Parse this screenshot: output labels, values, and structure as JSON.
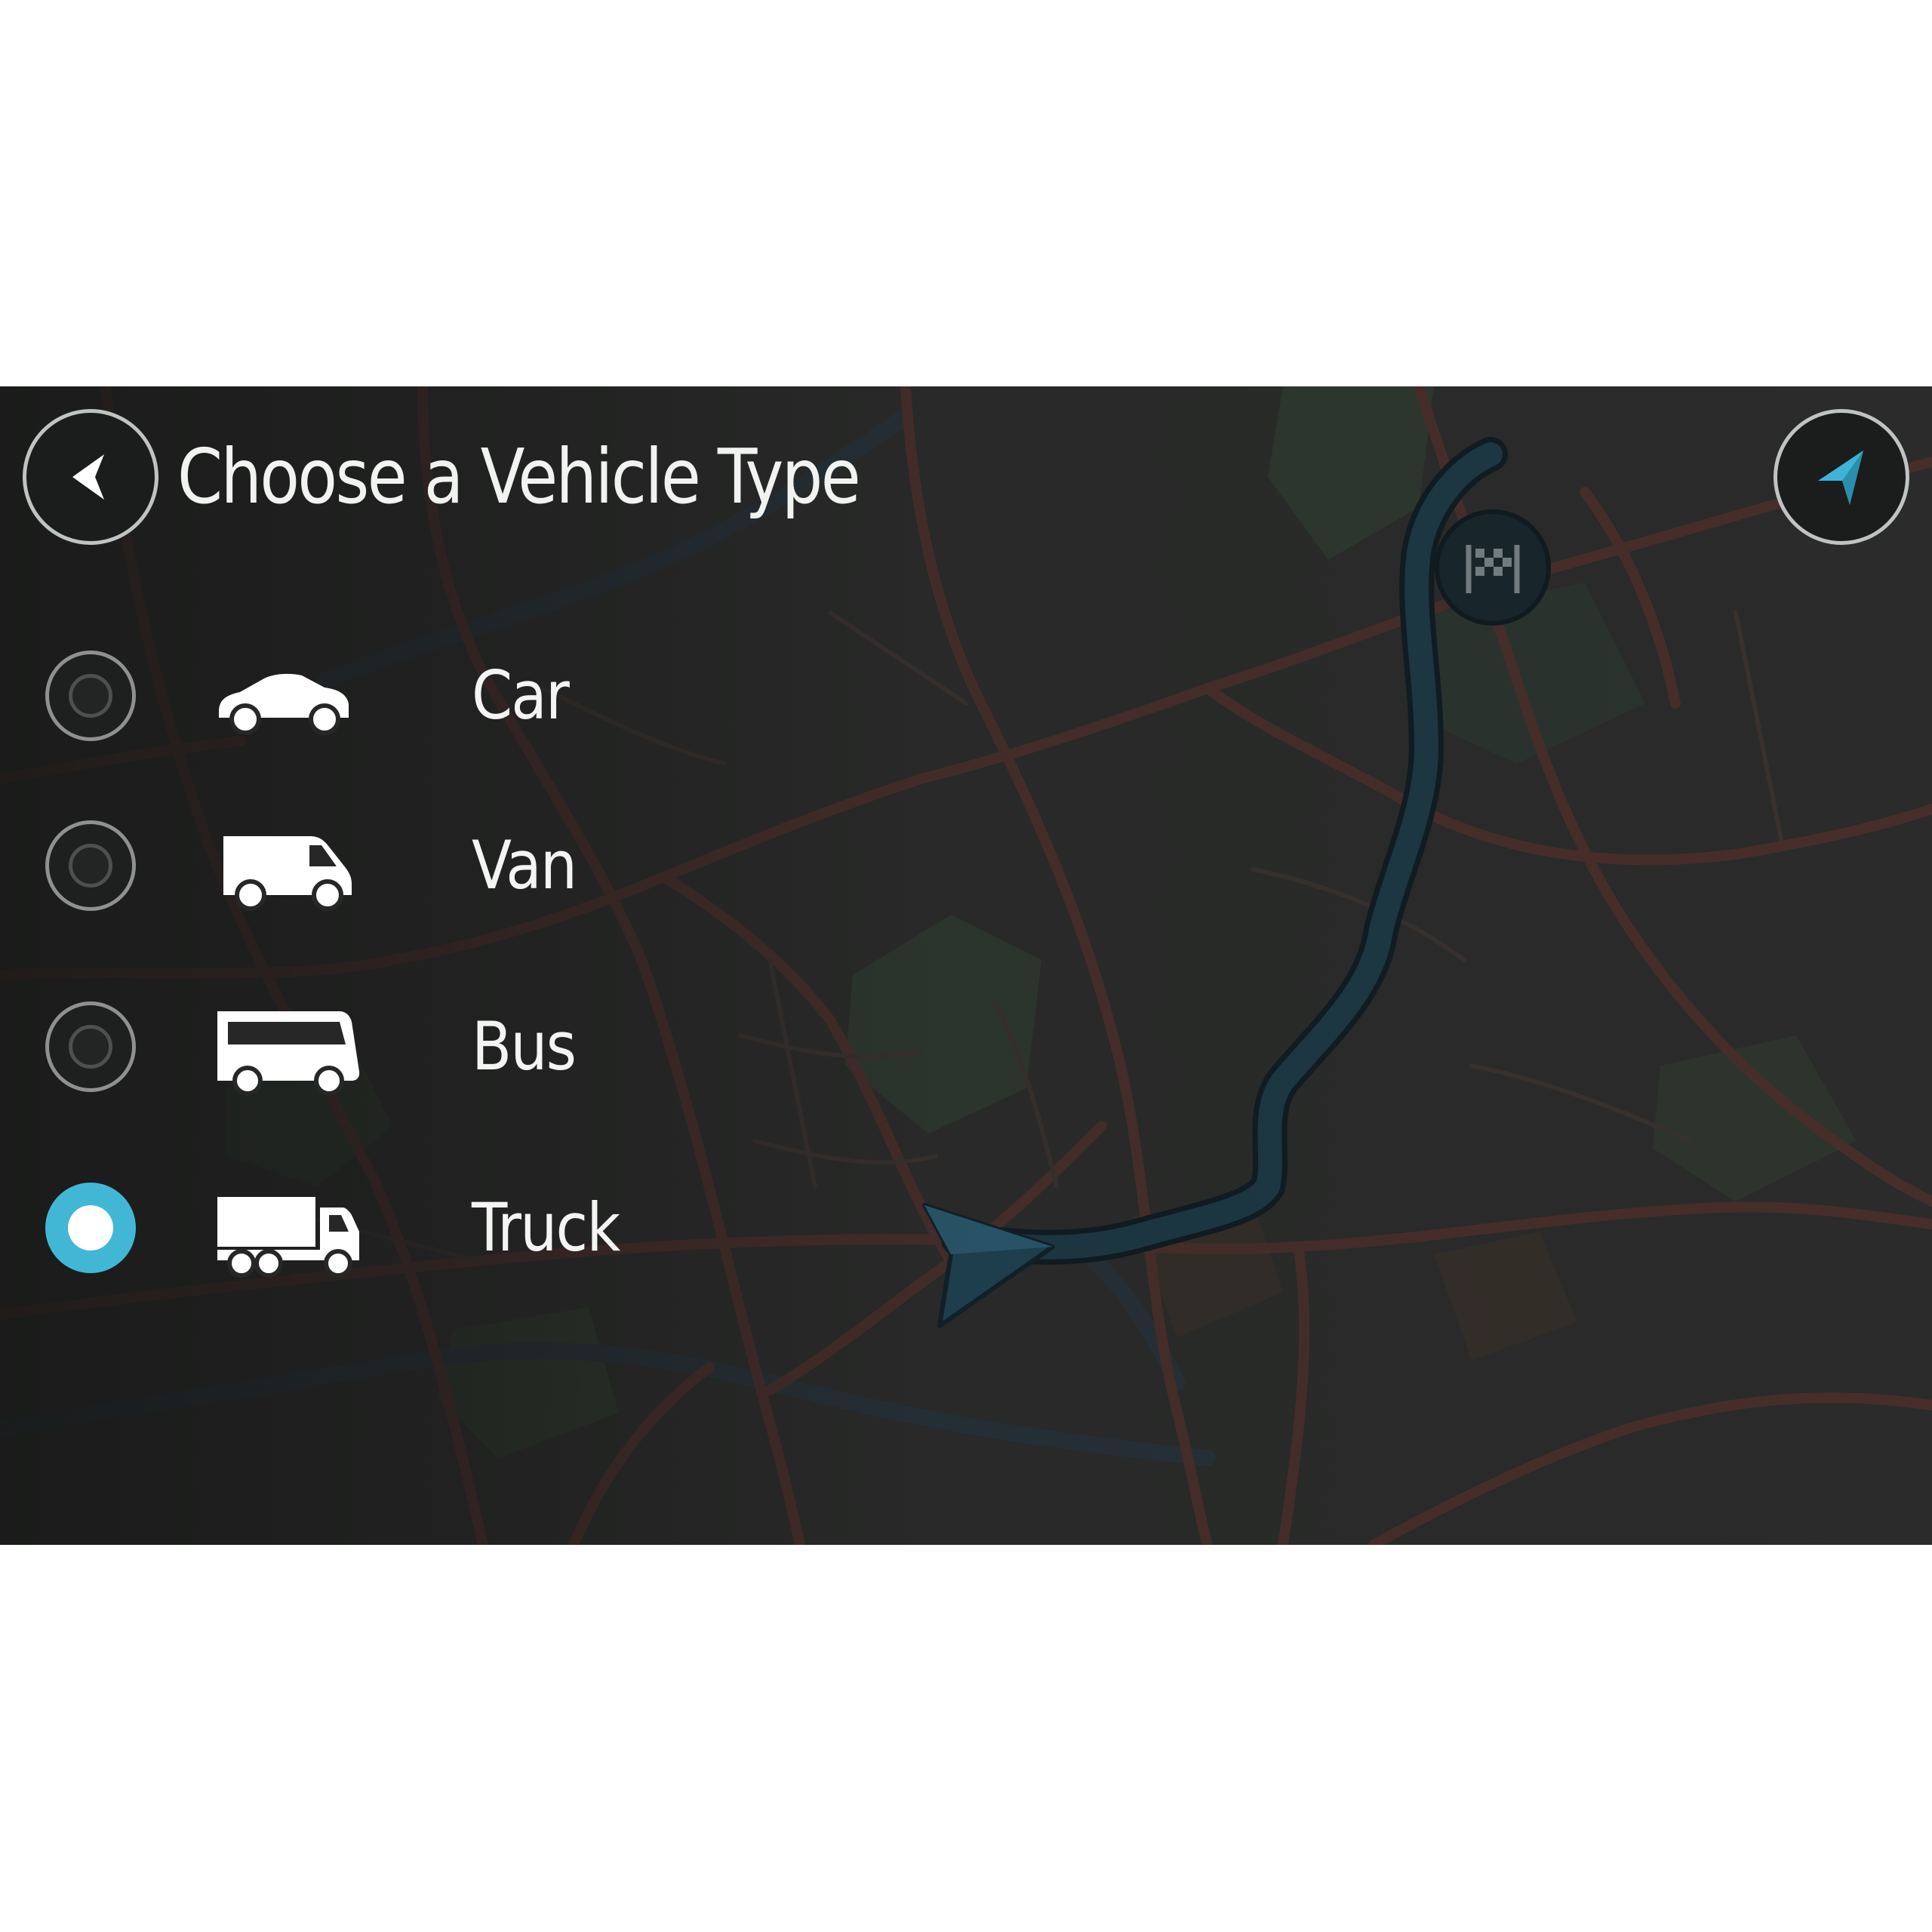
{
  "header": {
    "title": "Choose a Vehicle Type"
  },
  "vehicles": [
    {
      "label": "Car",
      "icon": "car-icon",
      "selected": false
    },
    {
      "label": "Van",
      "icon": "van-icon",
      "selected": false
    },
    {
      "label": "Bus",
      "icon": "bus-icon",
      "selected": false
    },
    {
      "label": "Truck",
      "icon": "truck-icon",
      "selected": true
    }
  ],
  "icons": {
    "back": "back-arrow-icon",
    "navigation": "navigation-arrow-icon",
    "destination": "checkered-flag-icon",
    "current_position": "position-chevron-icon"
  },
  "colors": {
    "accent": "#41b7d5",
    "route": "#1d3a47",
    "road": "#4a2f2c",
    "text": "#f1f3f1"
  }
}
